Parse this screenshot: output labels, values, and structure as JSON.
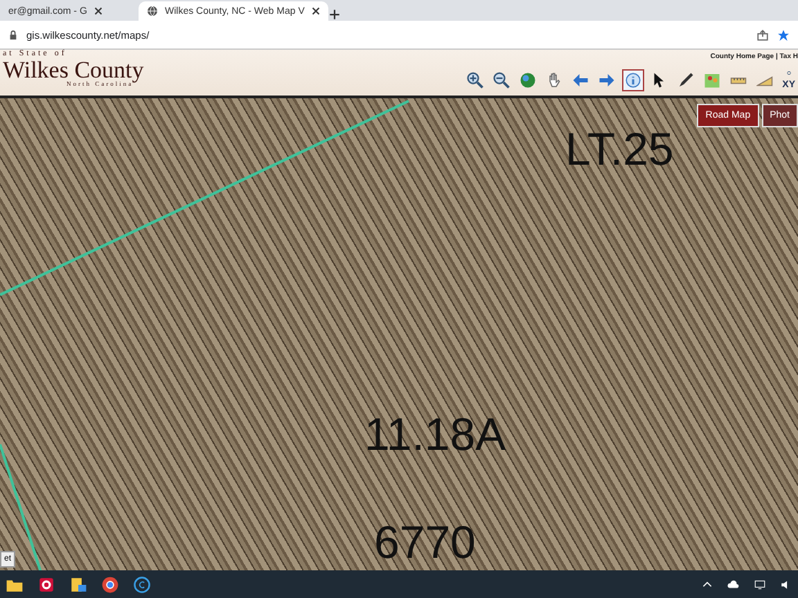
{
  "browser": {
    "tabs": [
      {
        "title": "er@gmail.com - G",
        "selected": false
      },
      {
        "title": "Wilkes County, NC - Web Map V",
        "selected": true
      }
    ],
    "address": "gis.wilkescounty.net/maps/"
  },
  "header": {
    "kicker": "at State of",
    "title": "Wilkes County",
    "subtitle": "North Carolina",
    "links": "County Home Page | Tax H",
    "tools": [
      {
        "kind": "zoom-in",
        "selected": false
      },
      {
        "kind": "zoom-out",
        "selected": false
      },
      {
        "kind": "globe",
        "selected": false
      },
      {
        "kind": "hand",
        "selected": false
      },
      {
        "kind": "back",
        "selected": false
      },
      {
        "kind": "forward",
        "selected": false
      },
      {
        "kind": "info",
        "selected": true
      },
      {
        "kind": "pointer",
        "selected": false
      },
      {
        "kind": "pencil",
        "selected": false
      },
      {
        "kind": "people",
        "selected": false
      },
      {
        "kind": "ruler",
        "selected": false
      },
      {
        "kind": "area",
        "selected": false
      },
      {
        "kind": "xy",
        "label": "XY",
        "selected": false
      }
    ]
  },
  "map": {
    "layers": [
      {
        "label": "Road Map",
        "selected": true
      },
      {
        "label": "Phot",
        "selected": false
      }
    ],
    "labels": [
      "LT.25",
      "11.18A",
      "6770"
    ],
    "tooltip": "et"
  }
}
